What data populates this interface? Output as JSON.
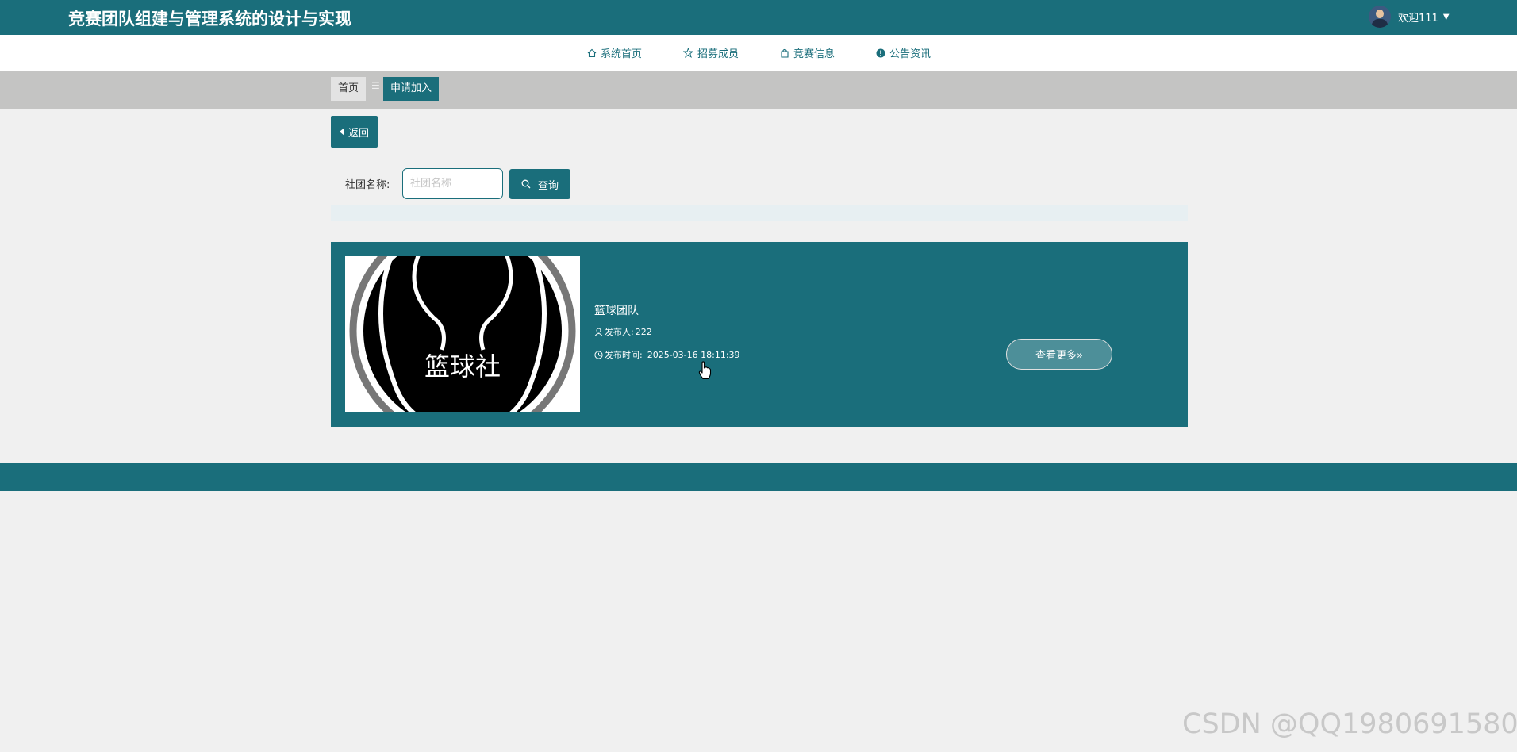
{
  "header": {
    "site_title": "竞赛团队组建与管理系统的设计与实现",
    "welcome_text": "欢迎111",
    "user_menu_caret": "▼"
  },
  "nav": {
    "items": [
      {
        "label": "系统首页",
        "icon": "home-icon"
      },
      {
        "label": "招募成员",
        "icon": "star-icon"
      },
      {
        "label": "竞赛信息",
        "icon": "bag-icon"
      },
      {
        "label": "公告资讯",
        "icon": "info-icon"
      }
    ]
  },
  "breadcrumb": {
    "home": "首页",
    "separator": "☰",
    "current": "申请加入"
  },
  "toolbar": {
    "back_label": "返回"
  },
  "search": {
    "label": "社团名称:",
    "placeholder": "社团名称",
    "value": "",
    "button_label": "查询"
  },
  "card": {
    "image_text": "篮球社",
    "title": "篮球团队",
    "publisher_label": "发布人:",
    "publisher_value": "222",
    "time_label": "发布时间:",
    "time_value": "2025-03-16 18:11:39",
    "more_label": "查看更多»"
  },
  "watermark": "CSDN @QQ1980691580",
  "colors": {
    "primary": "#1a6e7b",
    "breadcrumb_bar": "#c4c4c3",
    "page_bg": "#f0f0f0"
  }
}
